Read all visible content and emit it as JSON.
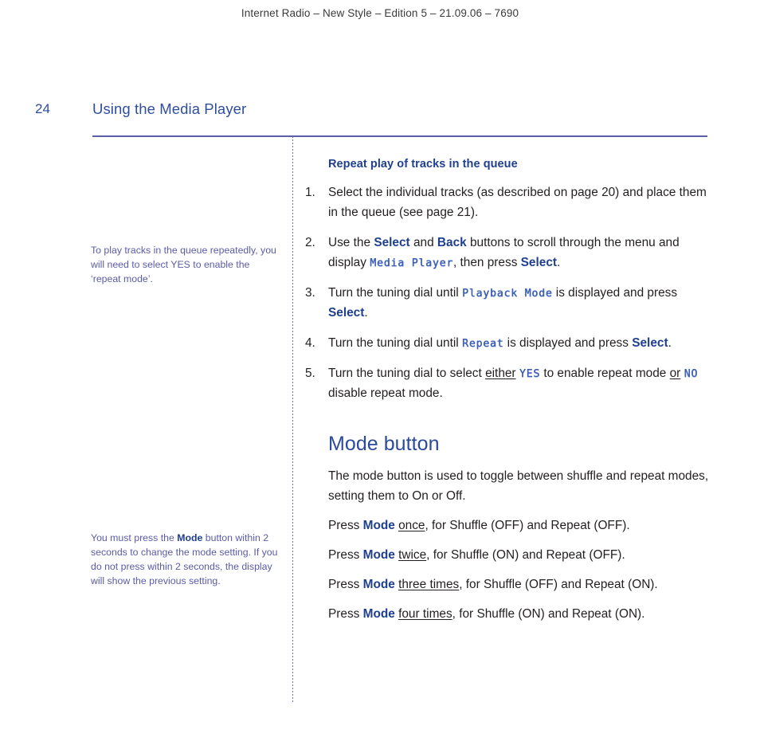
{
  "header": {
    "running_head": "Internet Radio – New Style – Edition 5 – 21.09.06 – 7690"
  },
  "page": {
    "number": "24",
    "title": "Using the Media Player"
  },
  "margin_notes": {
    "note_1": {
      "text_before": "To play tracks in the queue repeatedly, you will need to select YES to enable the ‘repeat mode’."
    },
    "note_2": {
      "part_1": "You must press the ",
      "emphasis": "Mode",
      "part_2": " button within 2 seconds to change the mode setting. If you do not press within 2 seconds, the display will show the previous setting."
    }
  },
  "main": {
    "sub_heading": "Repeat play of tracks in the queue",
    "steps": [
      {
        "num": "1.",
        "segments": [
          {
            "type": "text",
            "value": "Select the individual tracks (as described on page 20) and place them in the queue (see page 21)."
          }
        ]
      },
      {
        "num": "2.",
        "segments": [
          {
            "type": "text",
            "value": "Use the "
          },
          {
            "type": "ui",
            "value": "Select"
          },
          {
            "type": "text",
            "value": " and "
          },
          {
            "type": "ui",
            "value": "Back"
          },
          {
            "type": "text",
            "value": " buttons to scroll through the menu and display "
          },
          {
            "type": "lcd",
            "value": "Media Player"
          },
          {
            "type": "text",
            "value": ", then press "
          },
          {
            "type": "ui",
            "value": "Select"
          },
          {
            "type": "text",
            "value": "."
          }
        ]
      },
      {
        "num": "3.",
        "segments": [
          {
            "type": "text",
            "value": "Turn the tuning dial until "
          },
          {
            "type": "lcd",
            "value": "Playback Mode"
          },
          {
            "type": "text",
            "value": " is displayed and press "
          },
          {
            "type": "ui",
            "value": "Select"
          },
          {
            "type": "text",
            "value": "."
          }
        ]
      },
      {
        "num": "4.",
        "segments": [
          {
            "type": "text",
            "value": "Turn the tuning dial until "
          },
          {
            "type": "lcd",
            "value": "Repeat"
          },
          {
            "type": "text",
            "value": " is displayed and press "
          },
          {
            "type": "ui",
            "value": "Select"
          },
          {
            "type": "text",
            "value": "."
          }
        ]
      },
      {
        "num": "5.",
        "segments": [
          {
            "type": "text",
            "value": "Turn the tuning dial to select "
          },
          {
            "type": "underline",
            "value": "either"
          },
          {
            "type": "text",
            "value": " "
          },
          {
            "type": "lcd",
            "value": "YES"
          },
          {
            "type": "text",
            "value": " to enable repeat mode "
          },
          {
            "type": "underline",
            "value": "or"
          },
          {
            "type": "text",
            "value": " "
          },
          {
            "type": "lcd",
            "value": "NO"
          },
          {
            "type": "text",
            "value": " disable repeat mode."
          }
        ]
      }
    ],
    "section_heading": "Mode button",
    "intro_paragraph": "The mode button is used to toggle between shuffle and repeat modes, setting them to On or Off.",
    "mode_lines": [
      {
        "segments": [
          {
            "type": "text",
            "value": "Press "
          },
          {
            "type": "ui",
            "value": "Mode"
          },
          {
            "type": "text",
            "value": " "
          },
          {
            "type": "underline",
            "value": "once"
          },
          {
            "type": "text",
            "value": ", for Shuffle (OFF) and Repeat (OFF)."
          }
        ]
      },
      {
        "segments": [
          {
            "type": "text",
            "value": "Press "
          },
          {
            "type": "ui",
            "value": "Mode"
          },
          {
            "type": "text",
            "value": " "
          },
          {
            "type": "underline",
            "value": "twice"
          },
          {
            "type": "text",
            "value": ", for Shuffle (ON) and Repeat (OFF)."
          }
        ]
      },
      {
        "segments": [
          {
            "type": "text",
            "value": "Press "
          },
          {
            "type": "ui",
            "value": "Mode"
          },
          {
            "type": "text",
            "value": " "
          },
          {
            "type": "underline",
            "value": "three times"
          },
          {
            "type": "text",
            "value": ", for Shuffle (OFF) and Repeat (ON)."
          }
        ]
      },
      {
        "segments": [
          {
            "type": "text",
            "value": "Press "
          },
          {
            "type": "ui",
            "value": "Mode"
          },
          {
            "type": "text",
            "value": " "
          },
          {
            "type": "underline",
            "value": "four times"
          },
          {
            "type": "text",
            "value": ", for Shuffle (ON) and Repeat (ON)."
          }
        ]
      }
    ]
  },
  "colors": {
    "accent_blue": "#1f3f8f",
    "heading_blue": "#2b4a9b",
    "title_blue": "#2f4e9e",
    "note_purple": "#5a5ba8",
    "rule_purple": "#5b5ea6",
    "lcd_blue": "#3a5fb5",
    "body_text": "#231f20"
  }
}
